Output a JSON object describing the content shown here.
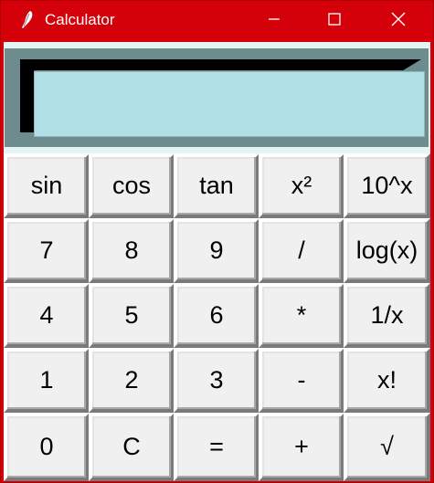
{
  "window": {
    "title": "Calculator",
    "accent_color": "#d4000a",
    "display_bg": "#b0e0e6",
    "controls": {
      "minimize_icon": "minimize-icon",
      "maximize_icon": "maximize-icon",
      "close_icon": "close-icon"
    }
  },
  "display": {
    "value": ""
  },
  "keys": {
    "row0": [
      "sin",
      "cos",
      "tan",
      "x²",
      "10^x"
    ],
    "row1": [
      "7",
      "8",
      "9",
      "/",
      "log(x)"
    ],
    "row2": [
      "4",
      "5",
      "6",
      "*",
      "1/x"
    ],
    "row3": [
      "1",
      "2",
      "3",
      "-",
      "x!"
    ],
    "row4": [
      "0",
      "C",
      "=",
      "+",
      "√"
    ]
  }
}
